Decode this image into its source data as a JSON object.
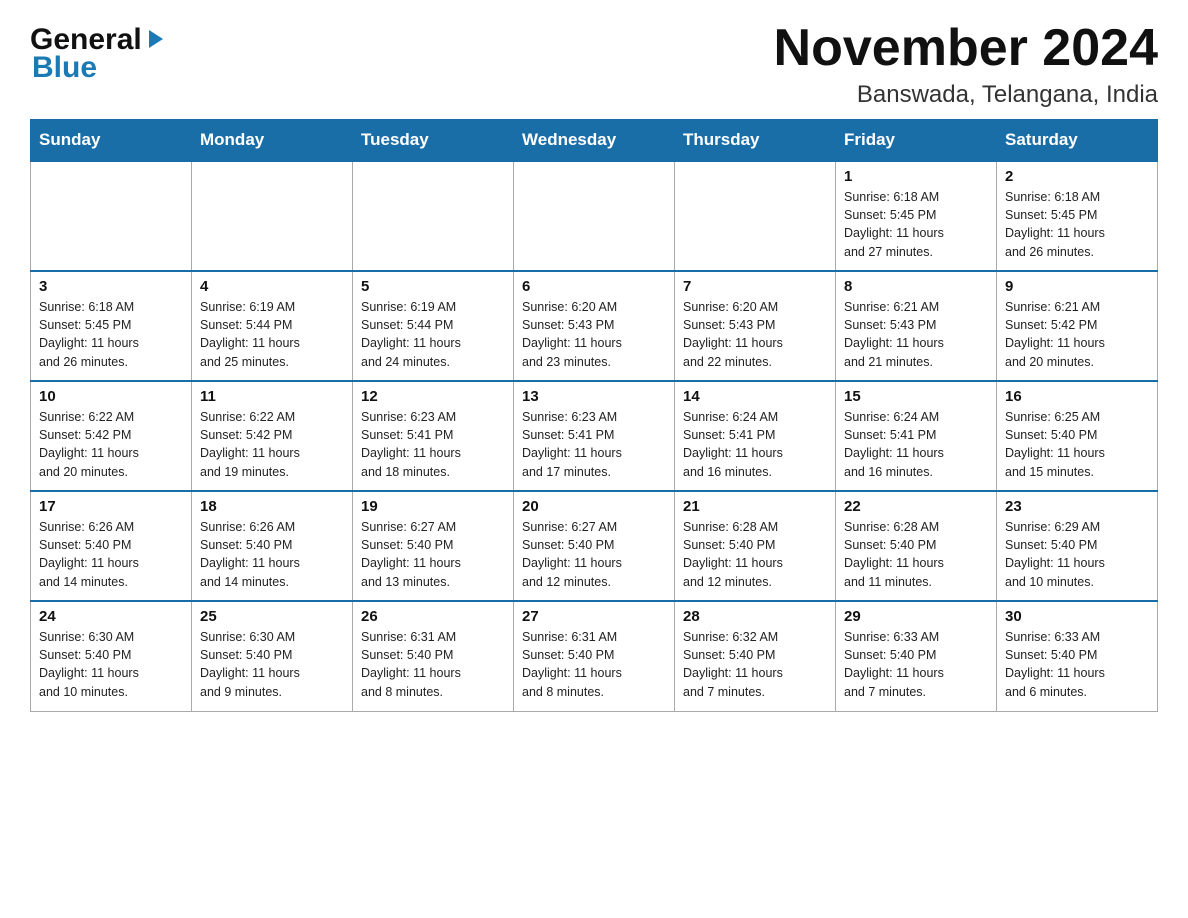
{
  "logo": {
    "general": "General",
    "blue": "Blue"
  },
  "header": {
    "month_year": "November 2024",
    "location": "Banswada, Telangana, India"
  },
  "weekdays": [
    "Sunday",
    "Monday",
    "Tuesday",
    "Wednesday",
    "Thursday",
    "Friday",
    "Saturday"
  ],
  "weeks": [
    [
      {
        "day": "",
        "info": ""
      },
      {
        "day": "",
        "info": ""
      },
      {
        "day": "",
        "info": ""
      },
      {
        "day": "",
        "info": ""
      },
      {
        "day": "",
        "info": ""
      },
      {
        "day": "1",
        "info": "Sunrise: 6:18 AM\nSunset: 5:45 PM\nDaylight: 11 hours\nand 27 minutes."
      },
      {
        "day": "2",
        "info": "Sunrise: 6:18 AM\nSunset: 5:45 PM\nDaylight: 11 hours\nand 26 minutes."
      }
    ],
    [
      {
        "day": "3",
        "info": "Sunrise: 6:18 AM\nSunset: 5:45 PM\nDaylight: 11 hours\nand 26 minutes."
      },
      {
        "day": "4",
        "info": "Sunrise: 6:19 AM\nSunset: 5:44 PM\nDaylight: 11 hours\nand 25 minutes."
      },
      {
        "day": "5",
        "info": "Sunrise: 6:19 AM\nSunset: 5:44 PM\nDaylight: 11 hours\nand 24 minutes."
      },
      {
        "day": "6",
        "info": "Sunrise: 6:20 AM\nSunset: 5:43 PM\nDaylight: 11 hours\nand 23 minutes."
      },
      {
        "day": "7",
        "info": "Sunrise: 6:20 AM\nSunset: 5:43 PM\nDaylight: 11 hours\nand 22 minutes."
      },
      {
        "day": "8",
        "info": "Sunrise: 6:21 AM\nSunset: 5:43 PM\nDaylight: 11 hours\nand 21 minutes."
      },
      {
        "day": "9",
        "info": "Sunrise: 6:21 AM\nSunset: 5:42 PM\nDaylight: 11 hours\nand 20 minutes."
      }
    ],
    [
      {
        "day": "10",
        "info": "Sunrise: 6:22 AM\nSunset: 5:42 PM\nDaylight: 11 hours\nand 20 minutes."
      },
      {
        "day": "11",
        "info": "Sunrise: 6:22 AM\nSunset: 5:42 PM\nDaylight: 11 hours\nand 19 minutes."
      },
      {
        "day": "12",
        "info": "Sunrise: 6:23 AM\nSunset: 5:41 PM\nDaylight: 11 hours\nand 18 minutes."
      },
      {
        "day": "13",
        "info": "Sunrise: 6:23 AM\nSunset: 5:41 PM\nDaylight: 11 hours\nand 17 minutes."
      },
      {
        "day": "14",
        "info": "Sunrise: 6:24 AM\nSunset: 5:41 PM\nDaylight: 11 hours\nand 16 minutes."
      },
      {
        "day": "15",
        "info": "Sunrise: 6:24 AM\nSunset: 5:41 PM\nDaylight: 11 hours\nand 16 minutes."
      },
      {
        "day": "16",
        "info": "Sunrise: 6:25 AM\nSunset: 5:40 PM\nDaylight: 11 hours\nand 15 minutes."
      }
    ],
    [
      {
        "day": "17",
        "info": "Sunrise: 6:26 AM\nSunset: 5:40 PM\nDaylight: 11 hours\nand 14 minutes."
      },
      {
        "day": "18",
        "info": "Sunrise: 6:26 AM\nSunset: 5:40 PM\nDaylight: 11 hours\nand 14 minutes."
      },
      {
        "day": "19",
        "info": "Sunrise: 6:27 AM\nSunset: 5:40 PM\nDaylight: 11 hours\nand 13 minutes."
      },
      {
        "day": "20",
        "info": "Sunrise: 6:27 AM\nSunset: 5:40 PM\nDaylight: 11 hours\nand 12 minutes."
      },
      {
        "day": "21",
        "info": "Sunrise: 6:28 AM\nSunset: 5:40 PM\nDaylight: 11 hours\nand 12 minutes."
      },
      {
        "day": "22",
        "info": "Sunrise: 6:28 AM\nSunset: 5:40 PM\nDaylight: 11 hours\nand 11 minutes."
      },
      {
        "day": "23",
        "info": "Sunrise: 6:29 AM\nSunset: 5:40 PM\nDaylight: 11 hours\nand 10 minutes."
      }
    ],
    [
      {
        "day": "24",
        "info": "Sunrise: 6:30 AM\nSunset: 5:40 PM\nDaylight: 11 hours\nand 10 minutes."
      },
      {
        "day": "25",
        "info": "Sunrise: 6:30 AM\nSunset: 5:40 PM\nDaylight: 11 hours\nand 9 minutes."
      },
      {
        "day": "26",
        "info": "Sunrise: 6:31 AM\nSunset: 5:40 PM\nDaylight: 11 hours\nand 8 minutes."
      },
      {
        "day": "27",
        "info": "Sunrise: 6:31 AM\nSunset: 5:40 PM\nDaylight: 11 hours\nand 8 minutes."
      },
      {
        "day": "28",
        "info": "Sunrise: 6:32 AM\nSunset: 5:40 PM\nDaylight: 11 hours\nand 7 minutes."
      },
      {
        "day": "29",
        "info": "Sunrise: 6:33 AM\nSunset: 5:40 PM\nDaylight: 11 hours\nand 7 minutes."
      },
      {
        "day": "30",
        "info": "Sunrise: 6:33 AM\nSunset: 5:40 PM\nDaylight: 11 hours\nand 6 minutes."
      }
    ]
  ]
}
